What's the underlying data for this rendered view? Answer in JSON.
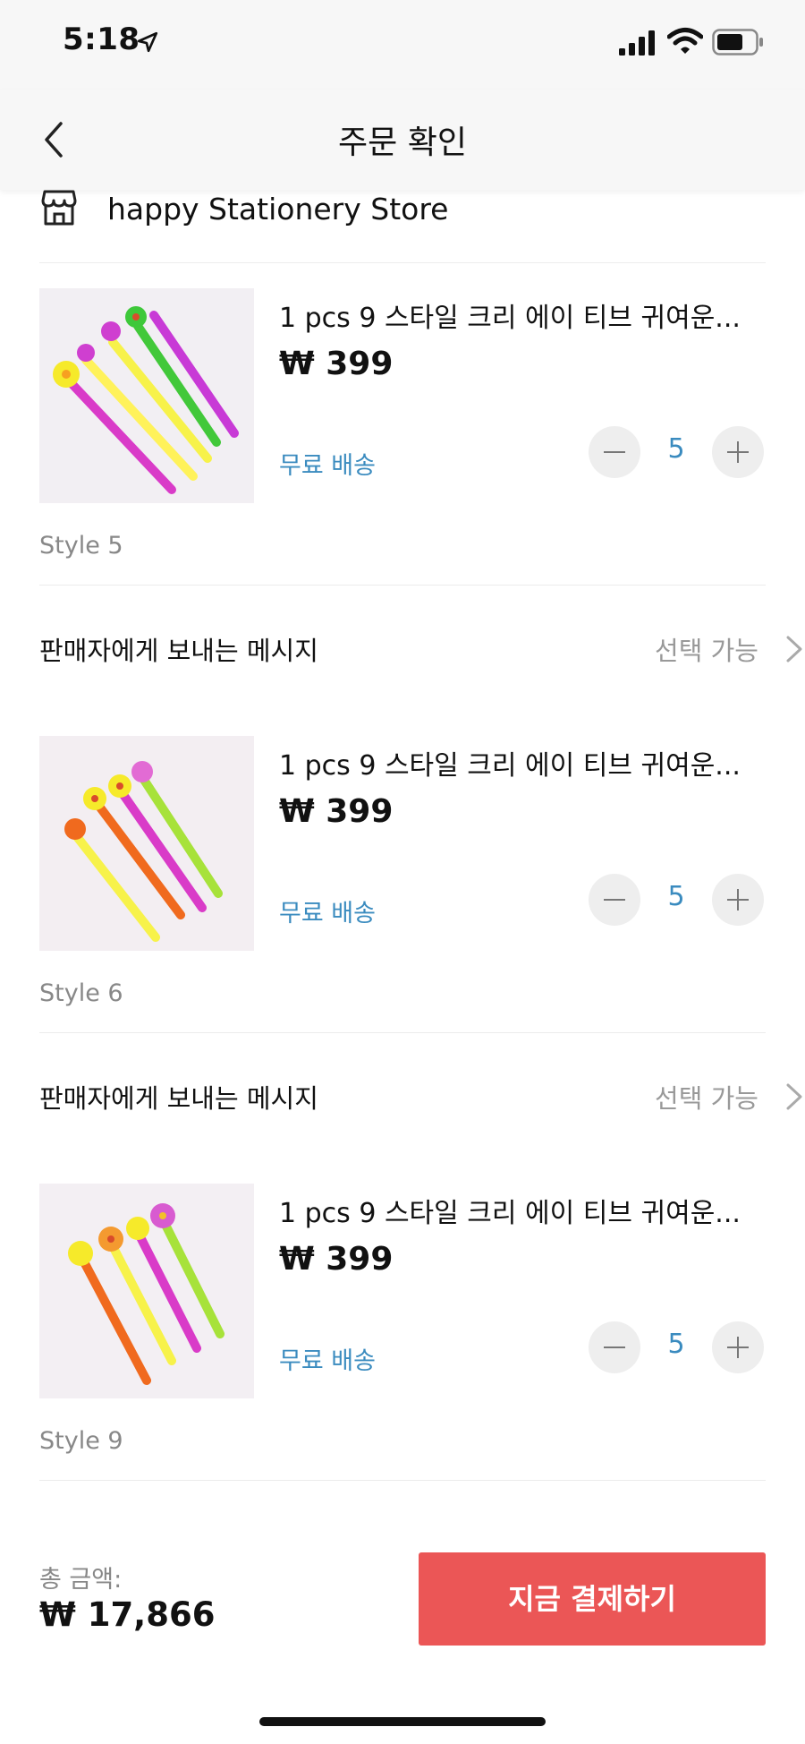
{
  "status_bar": {
    "time": "5:18"
  },
  "header": {
    "title": "주문 확인"
  },
  "store": {
    "name": "happy Stationery Store"
  },
  "products": [
    {
      "title": "1 pcs 9 스타일 크리 에이 티브 귀여운...",
      "price": "₩ 399",
      "shipping": "무료 배송",
      "quantity": "5",
      "style": "Style 5"
    },
    {
      "title": "1 pcs 9 스타일 크리 에이 티브 귀여운...",
      "price": "₩ 399",
      "shipping": "무료 배송",
      "quantity": "5",
      "style": "Style 6"
    },
    {
      "title": "1 pcs 9 스타일 크리 에이 티브 귀여운...",
      "price": "₩ 399",
      "shipping": "무료 배송",
      "quantity": "5",
      "style": "Style 9"
    }
  ],
  "message_rows": [
    {
      "label": "판매자에게 보내는 메시지",
      "option": "선택 가능"
    },
    {
      "label": "판매자에게 보내는 메시지",
      "option": "선택 가능"
    }
  ],
  "footer": {
    "total_label": "총 금액:",
    "total_value": "₩ 17,866",
    "pay_label": "지금 결제하기"
  },
  "colors": {
    "accent_blue": "#3a8bbf",
    "pay_red": "#eb5656"
  },
  "icons": [
    "location-arrow-icon",
    "signal-icon",
    "wifi-icon",
    "battery-icon",
    "back-icon",
    "store-icon",
    "chevron-right-icon"
  ]
}
